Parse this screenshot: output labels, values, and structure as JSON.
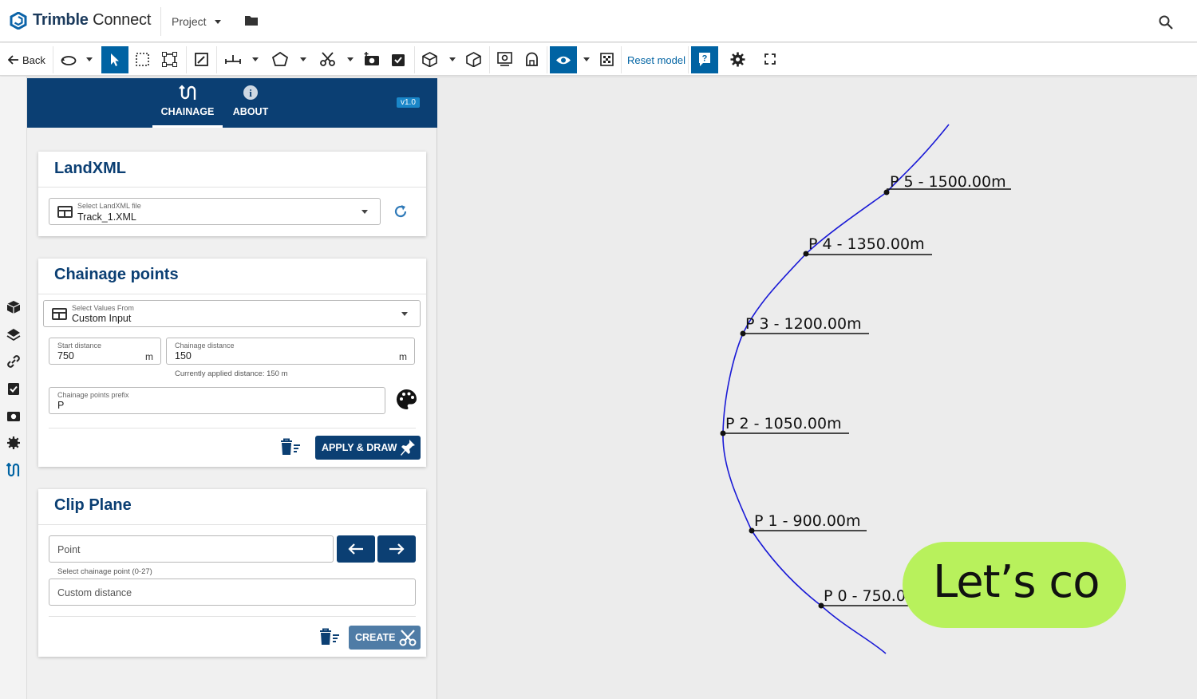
{
  "app": {
    "brand_bold": "Trimble",
    "brand_light": "Connect",
    "project_label": "Project"
  },
  "toolbar": {
    "back_label": "Back",
    "reset_label": "Reset model"
  },
  "panel": {
    "tabs": [
      {
        "label": "CHAINAGE"
      },
      {
        "label": "ABOUT"
      }
    ],
    "version": "v1.0",
    "landxml": {
      "title": "LandXML",
      "select_label": "Select LandXML file",
      "select_value": "Track_1.XML"
    },
    "chainage": {
      "title": "Chainage points",
      "values_label": "Select Values From",
      "values_value": "Custom Input",
      "start_label": "Start distance",
      "start_value": "750",
      "start_unit": "m",
      "dist_label": "Chainage distance",
      "dist_value": "150",
      "dist_unit": "m",
      "applied_hint": "Currently applied distance: 150 m",
      "prefix_label": "Chainage points prefix",
      "prefix_value": "P",
      "apply_label": "APPLY & DRAW"
    },
    "clip": {
      "title": "Clip Plane",
      "point_placeholder": "Point",
      "select_hint": "Select chainage point (0-27)",
      "custom_placeholder": "Custom distance",
      "create_label": "CREATE"
    }
  },
  "canvas": {
    "points": [
      {
        "label": "P 5 - 1500.00m"
      },
      {
        "label": "P 4 - 1350.00m"
      },
      {
        "label": "P 3 - 1200.00m"
      },
      {
        "label": "P 2 - 1050.00m"
      },
      {
        "label": "P 1 - 900.00m"
      },
      {
        "label": "P 0 - 750.00m"
      }
    ],
    "curve_color": "#1a1ad6"
  },
  "overlay": {
    "text": "Let’s co"
  }
}
